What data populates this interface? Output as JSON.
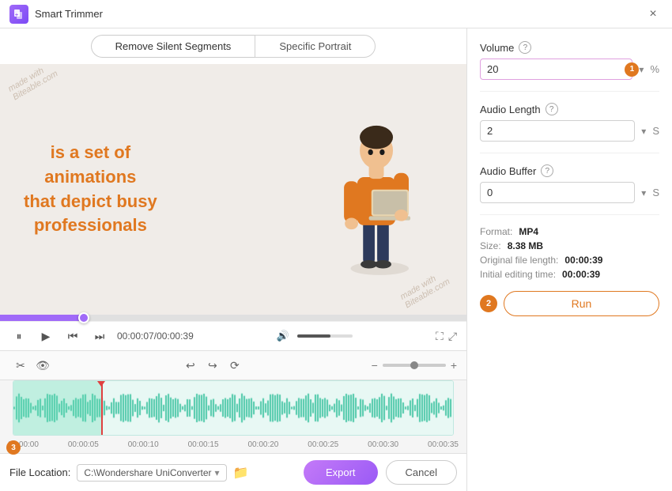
{
  "app": {
    "title": "Smart Trimmer",
    "close_label": "×"
  },
  "tabs": {
    "tab1": "Remove Silent Segments",
    "tab2": "Specific Portrait"
  },
  "video": {
    "text_line1": "is a set of",
    "text_line2": "animations",
    "text_line3": "that depict busy",
    "text_line4": "professionals",
    "watermark1": "made with\nBiteable.com",
    "watermark2": "made with\nBiteable.com"
  },
  "controls": {
    "time_current": "00:00:07",
    "time_total": "00:00:39"
  },
  "timeline": {
    "marks": [
      "00:00:00",
      "00:00:05",
      "00:00:10",
      "00:00:15",
      "00:00:20",
      "00:00:25",
      "00:00:30",
      "00:00:35"
    ]
  },
  "settings": {
    "volume_label": "Volume",
    "volume_value": "20",
    "volume_unit": "%",
    "audio_length_label": "Audio Length",
    "audio_length_value": "2",
    "audio_length_unit": "S",
    "audio_buffer_label": "Audio Buffer",
    "audio_buffer_value": "0",
    "audio_buffer_unit": "S",
    "format_label": "Format:",
    "format_value": "MP4",
    "size_label": "Size:",
    "size_value": "8.38 MB",
    "orig_length_label": "Original file length:",
    "orig_length_value": "00:00:39",
    "init_edit_label": "Initial editing time:",
    "init_edit_value": "00:00:39",
    "run_label": "Run",
    "badge1": "1",
    "badge2": "2"
  },
  "file_bar": {
    "label": "File Location:",
    "path": "C:\\Wondershare UniConverter",
    "export_label": "Export",
    "cancel_label": "Cancel"
  },
  "icons": {
    "pause": "⏸",
    "play": "▶",
    "prev": "⏮",
    "next": "⏭",
    "volume": "🔊",
    "fullscreen": "⛶",
    "expand": "⤢",
    "scissors": "✂",
    "eye": "👁",
    "undo": "↩",
    "redo": "↪",
    "forward": "⟳",
    "zoom_out": "−",
    "zoom_in": "+",
    "folder": "📁",
    "dropdown": "▾"
  }
}
